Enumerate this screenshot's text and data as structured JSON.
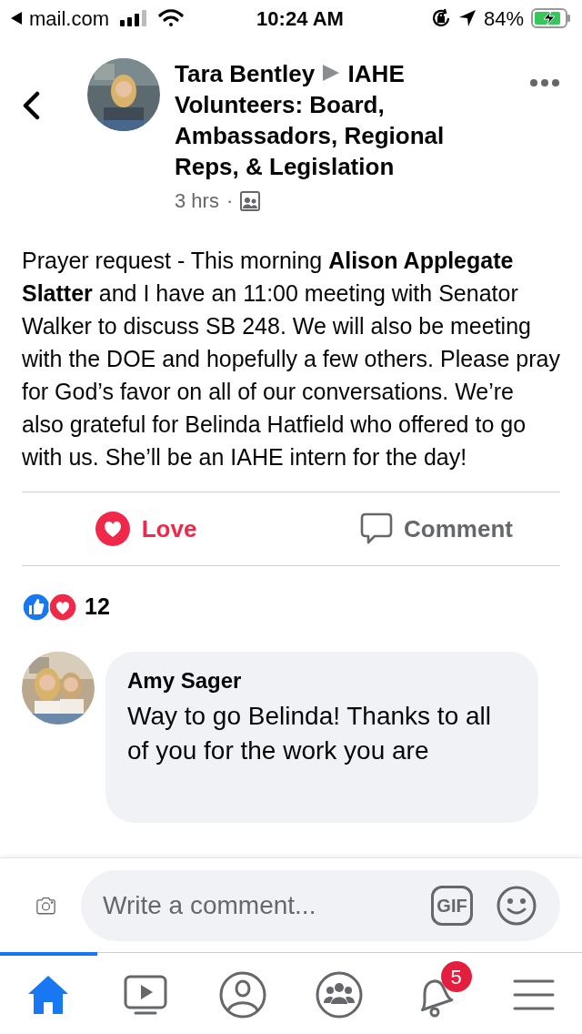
{
  "status_bar": {
    "back_app": "mail.com",
    "time": "10:24 AM",
    "battery": "84%"
  },
  "post": {
    "author": "Tara Bentley",
    "group": "IAHE Volunteers:  Board, Ambassadors, Regional Reps, & Legislation",
    "time": "3 hrs",
    "separator": "·",
    "text": "Prayer request - This morning **Alison Applegate Slatter** and I have an 11:00 meeting with Senator Walker to discuss SB 248. We will also be meeting with the DOE and hopefully a few others. Please pray for God’s favor on all of our conversations. We’re also grateful for Belinda Hatfield who offered to go with us. She’ll be an IAHE intern for the day!",
    "actions": [
      {
        "kind": "love",
        "label": "Love",
        "active": true
      },
      {
        "kind": "comment",
        "label": "Comment",
        "active": false
      }
    ],
    "reaction_count": "12"
  },
  "comments": [
    {
      "author": "Amy Sager",
      "text": "Way to go Belinda! Thanks to all of you for the work you are"
    }
  ],
  "composer": {
    "placeholder": "Write a comment...",
    "gif": "GIF"
  },
  "nav": [
    {
      "kind": "home",
      "selected": true
    },
    {
      "kind": "video",
      "selected": false
    },
    {
      "kind": "profile",
      "selected": false
    },
    {
      "kind": "groups",
      "selected": false
    },
    {
      "kind": "notifications",
      "selected": false,
      "badge": "5"
    },
    {
      "kind": "menu",
      "selected": false
    }
  ]
}
